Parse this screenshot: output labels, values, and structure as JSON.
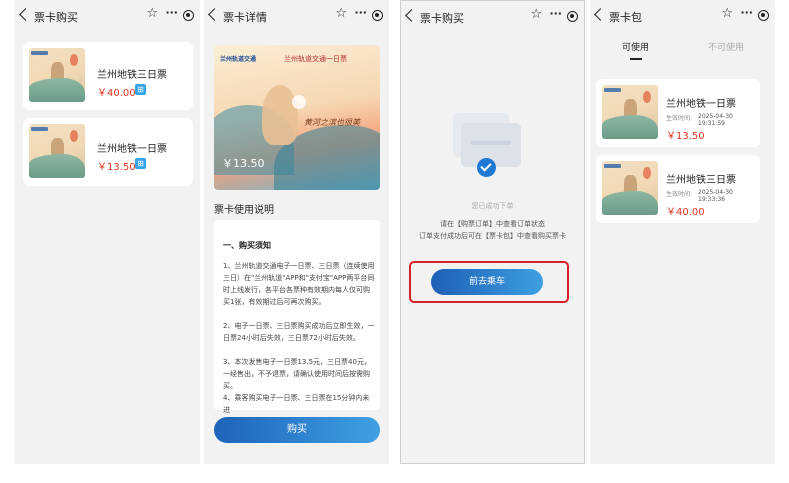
{
  "screen1": {
    "title": "票卡购买",
    "tickets": [
      {
        "name": "兰州地铁三日票",
        "price": "￥40.00"
      },
      {
        "name": "兰州地铁一日票",
        "price": "￥13.50"
      }
    ]
  },
  "screen2": {
    "title": "票卡详情",
    "banner": {
      "logo": "兰州轨道交通",
      "headline": "兰州轨道交通一日票",
      "poem": "黄河之滨也很美",
      "price": "￥13.50"
    },
    "section_title": "票卡使用说明",
    "notice_heading": "一、购买须知",
    "paragraphs": [
      "1、兰州轨道交通电子一日票、三日票（连续使用三日）在\"兰州轨道\"APP和\"支付宝\"APP两平台同时上线发行，各平台各票种有效期内每人仅可购买1张，有效期过后可再次购买。",
      "2、电子一日票、三日票购买成功后立即生效，一日票24小时后失效，三日票72小时后失效。",
      "3、本次发售电子一日票13.5元，三日票40元，一经售出，不予退票，请确认使用时间后按需购买。",
      "4、乘客购买电子一日票、三日票在15分钟内未进"
    ],
    "buy_label": "购买"
  },
  "screen3": {
    "title": "票卡购买",
    "status": "您已成功下单",
    "line1": "请在【购票订单】中查看订单状态",
    "line2": "订单支付成功后可在【票卡包】中查看购买票卡",
    "go_label": "前去乘车"
  },
  "screen4": {
    "title": "票卡包",
    "tab_active": "可使用",
    "tab_inactive": "不可使用",
    "cards": [
      {
        "name": "兰州地铁一日票",
        "time_label": "生效时间:",
        "time": "2025-04-30 19:31:59",
        "price": "￥13.50"
      },
      {
        "name": "兰州地铁三日票",
        "time_label": "生效时间:",
        "time": "2025-04-30 19:33:36",
        "price": "￥40.00"
      }
    ]
  },
  "icons": {
    "back": "chevron-left-icon",
    "star": "star-icon",
    "more": "more-icon",
    "record": "record-icon",
    "cart": "cart-icon",
    "check": "check-icon"
  },
  "colors": {
    "price_red": "#e0341f",
    "primary_blue": "#1e63b8",
    "highlight_red": "#d8202a"
  }
}
